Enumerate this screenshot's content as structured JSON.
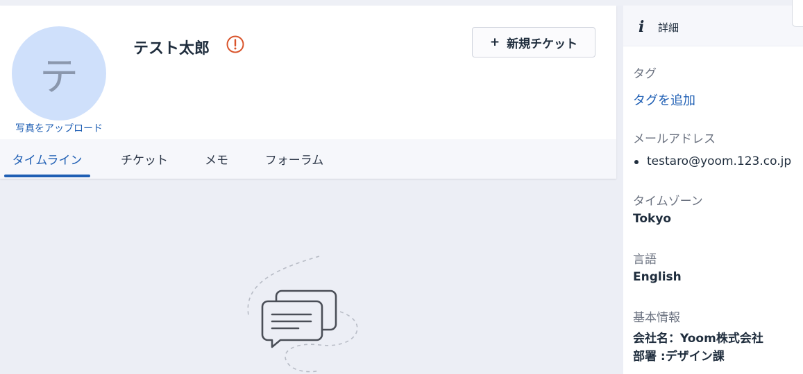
{
  "customer": {
    "avatar_initial": "テ",
    "upload_label": "写真をアップロード",
    "name": "テスト太郎"
  },
  "actions": {
    "new_ticket_icon": "+",
    "new_ticket_label": "新規チケット"
  },
  "tabs": [
    {
      "label": "タイムライン",
      "active": true
    },
    {
      "label": "チケット",
      "active": false
    },
    {
      "label": "メモ",
      "active": false
    },
    {
      "label": "フォーラム",
      "active": false
    }
  ],
  "details": {
    "icon": "i",
    "title": "詳細",
    "tags_label": "タグ",
    "add_tag_link": "タグを追加",
    "email_label": "メールアドレス",
    "email_value": "testaro@yoom.123.co.jp",
    "timezone_label": "タイムゾーン",
    "timezone_value": "Tokyo",
    "language_label": "言語",
    "language_value": "English",
    "basic_info_label": "基本情報",
    "company_line": "会社名：Yoom株式会社",
    "department_line": "部署 :デザイン課"
  },
  "colors": {
    "accent": "#1f5fb4",
    "warning": "#d9542b",
    "avatar_bg": "#cfe0fb"
  },
  "icons": [
    "warning-circle-icon",
    "plus-icon",
    "info-icon",
    "chat-bubbles-icon"
  ]
}
